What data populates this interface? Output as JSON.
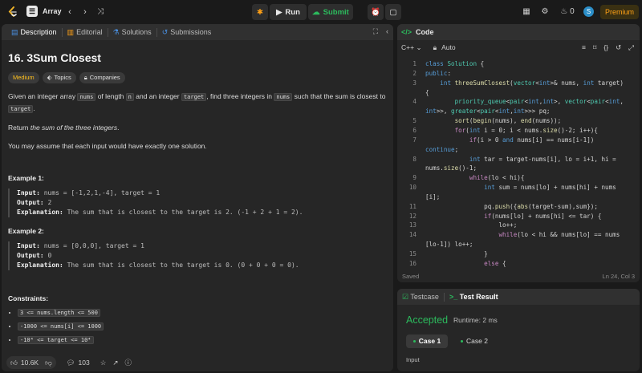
{
  "topbar": {
    "problem_list": "Array",
    "run": "Run",
    "submit": "Submit",
    "streak": "0",
    "avatar": "S",
    "premium": "Premium"
  },
  "left_tabs": [
    "Description",
    "Editorial",
    "Solutions",
    "Submissions"
  ],
  "problem": {
    "title": "16. 3Sum Closest",
    "difficulty": "Medium",
    "topics": "Topics",
    "companies": "Companies",
    "p1_a": "Given an integer array ",
    "p1_nums": "nums",
    "p1_b": " of length ",
    "p1_n": "n",
    "p1_c": " and an integer ",
    "p1_target": "target",
    "p1_d": ", find three integers in ",
    "p1_nums2": "nums",
    "p1_e": " such that the sum is closest to ",
    "p1_target2": "target",
    "p1_f": ".",
    "p2_a": "Return ",
    "p2_em": "the sum of the three integers",
    "p2_b": ".",
    "p3": "You may assume that each input would have exactly one solution.",
    "examples": [
      {
        "heading": "Example 1:",
        "input_label": "Input:",
        "input": " nums = [-1,2,1,-4], target = 1",
        "output_label": "Output:",
        "output": " 2",
        "expl_label": "Explanation:",
        "explanation": " The sum that is closest to the target is 2. (-1 + 2 + 1 = 2)."
      },
      {
        "heading": "Example 2:",
        "input_label": "Input:",
        "input": " nums = [0,0,0], target = 1",
        "output_label": "Output:",
        "output": " 0",
        "expl_label": "Explanation:",
        "explanation": " The sum that is closest to the target is 0. (0 + 0 + 0 = 0)."
      }
    ],
    "constraints_heading": "Constraints:",
    "constraints": [
      "3 <= nums.length <= 500",
      "-1000 <= nums[i] <= 1000",
      "-10⁴ <= target <= 10⁴"
    ]
  },
  "bottombar": {
    "likes": "10.6K",
    "comments": "103"
  },
  "code": {
    "title": "Code",
    "language": "C++",
    "mode": "Auto",
    "status": "Saved",
    "position": "Ln 24, Col 3",
    "lines": [
      {
        "n": "1",
        "t": "class Solution {"
      },
      {
        "n": "2",
        "t": "public:"
      },
      {
        "n": "3",
        "t": "    int threeSumClosest(vector<int>& nums, int target)"
      },
      {
        "n": "",
        "t": "{"
      },
      {
        "n": "4",
        "t": "        priority_queue<pair<int,int>, vector<pair<int,"
      },
      {
        "n": "",
        "t": "int>>, greater<pair<int,int>>> pq;"
      },
      {
        "n": "5",
        "t": "        sort(begin(nums), end(nums));"
      },
      {
        "n": "6",
        "t": "        for(int i = 0; i < nums.size()-2; i++){"
      },
      {
        "n": "7",
        "t": "            if(i > 0 and nums[i] == nums[i-1])"
      },
      {
        "n": "",
        "t": "continue;"
      },
      {
        "n": "8",
        "t": "            int tar = target-nums[i], lo = i+1, hi ="
      },
      {
        "n": "",
        "t": "nums.size()-1;"
      },
      {
        "n": "9",
        "t": "            while(lo < hi){"
      },
      {
        "n": "10",
        "t": "                int sum = nums[lo] + nums[hi] + nums"
      },
      {
        "n": "",
        "t": "[i];"
      },
      {
        "n": "11",
        "t": "                pq.push({abs(target-sum),sum});"
      },
      {
        "n": "12",
        "t": "                if(nums[lo] + nums[hi] <= tar) {"
      },
      {
        "n": "13",
        "t": "                    lo++;"
      },
      {
        "n": "14",
        "t": "                    while(lo < hi && nums[lo] == nums"
      },
      {
        "n": "",
        "t": "[lo-1]) lo++;"
      },
      {
        "n": "15",
        "t": "                }"
      },
      {
        "n": "16",
        "t": "                else {"
      }
    ]
  },
  "test": {
    "testcase_tab": "Testcase",
    "result_tab": "Test Result",
    "verdict": "Accepted",
    "runtime": "Runtime: 2 ms",
    "case1": "Case 1",
    "case2": "Case 2",
    "input_label": "Input"
  },
  "colors": {
    "accent": "#ffa116",
    "accepted": "#2cbb5d",
    "medium": "#ffc01e",
    "avatar": "#2b8ec8"
  }
}
